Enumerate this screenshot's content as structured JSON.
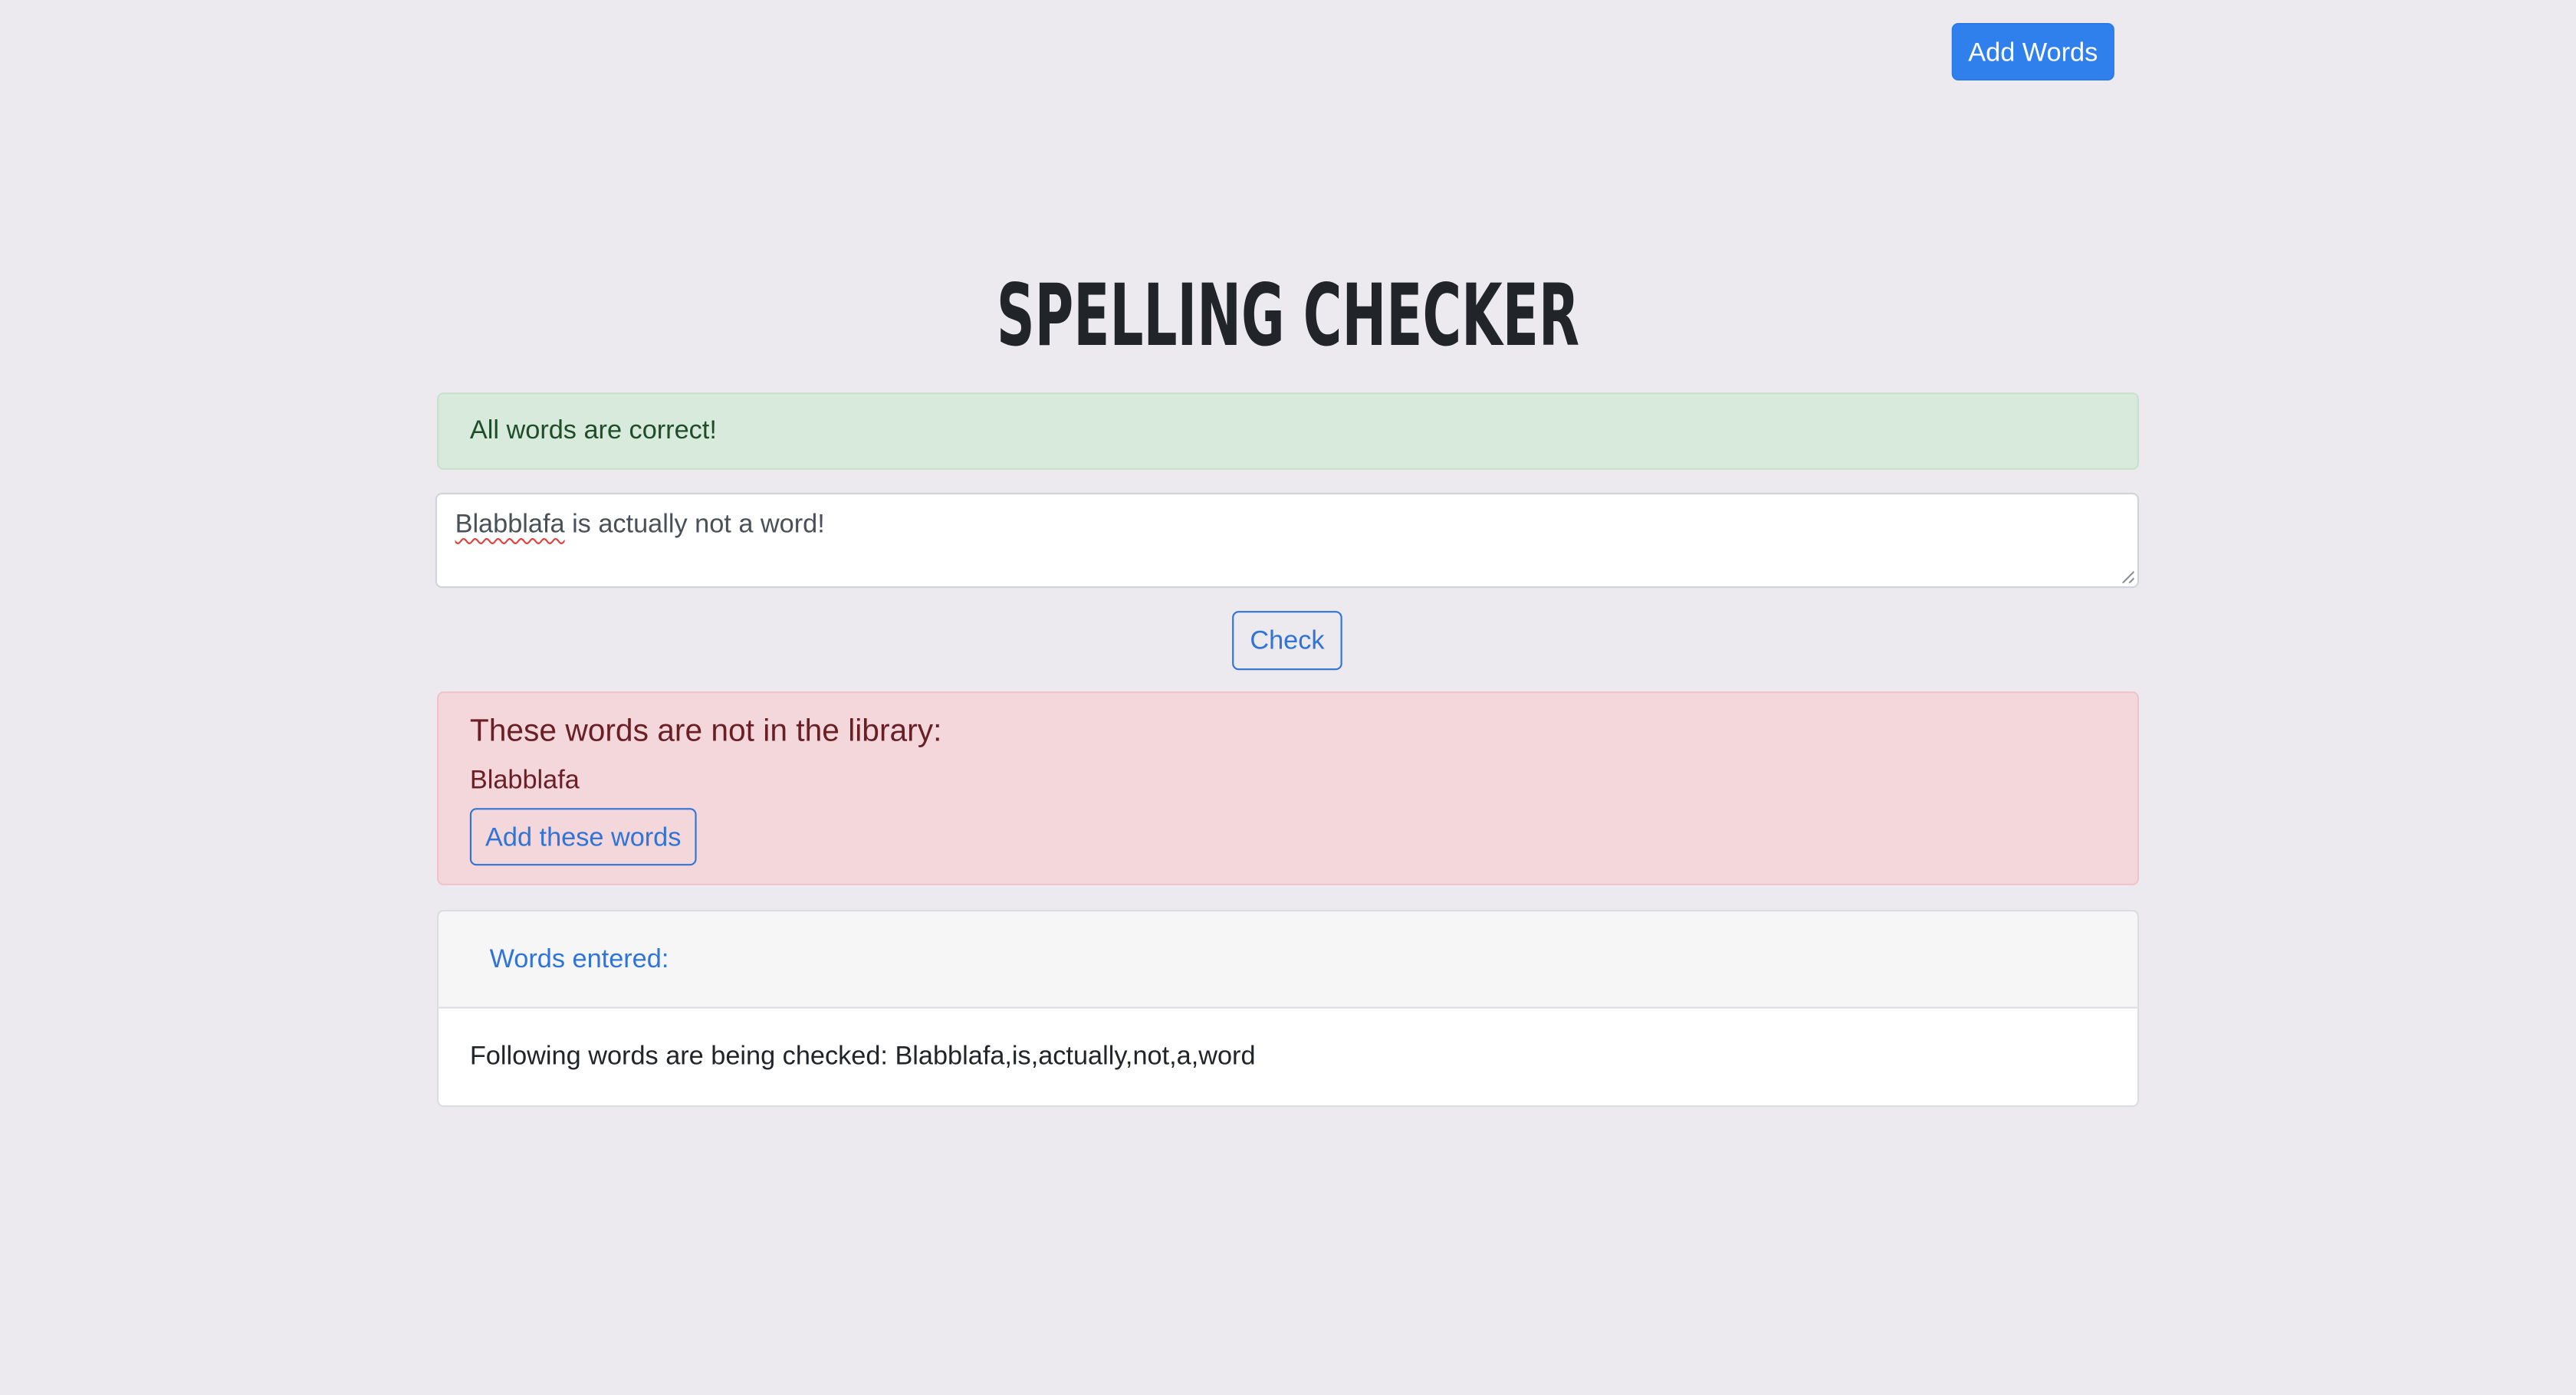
{
  "header": {
    "add_words_label": "Add Words"
  },
  "main": {
    "title": "SPELLING CHECKER",
    "success_alert": "All words are correct!",
    "input": {
      "misspelled_word": "Blabblafa",
      "rest_text": " is actually not a word!"
    },
    "check_label": "Check",
    "unknown_words": {
      "heading": "These words are not in the library:",
      "words": "Blabblafa",
      "add_button_label": "Add these words"
    },
    "words_entered": {
      "header_label": "Words entered:",
      "body_text": "Following words are being checked: Blabblafa,is,actually,not,a,word"
    }
  },
  "colors": {
    "background": "#ece9ef",
    "primary": "#2f80ed",
    "success_bg": "#d8eadb",
    "danger_bg": "#f4d7da"
  }
}
